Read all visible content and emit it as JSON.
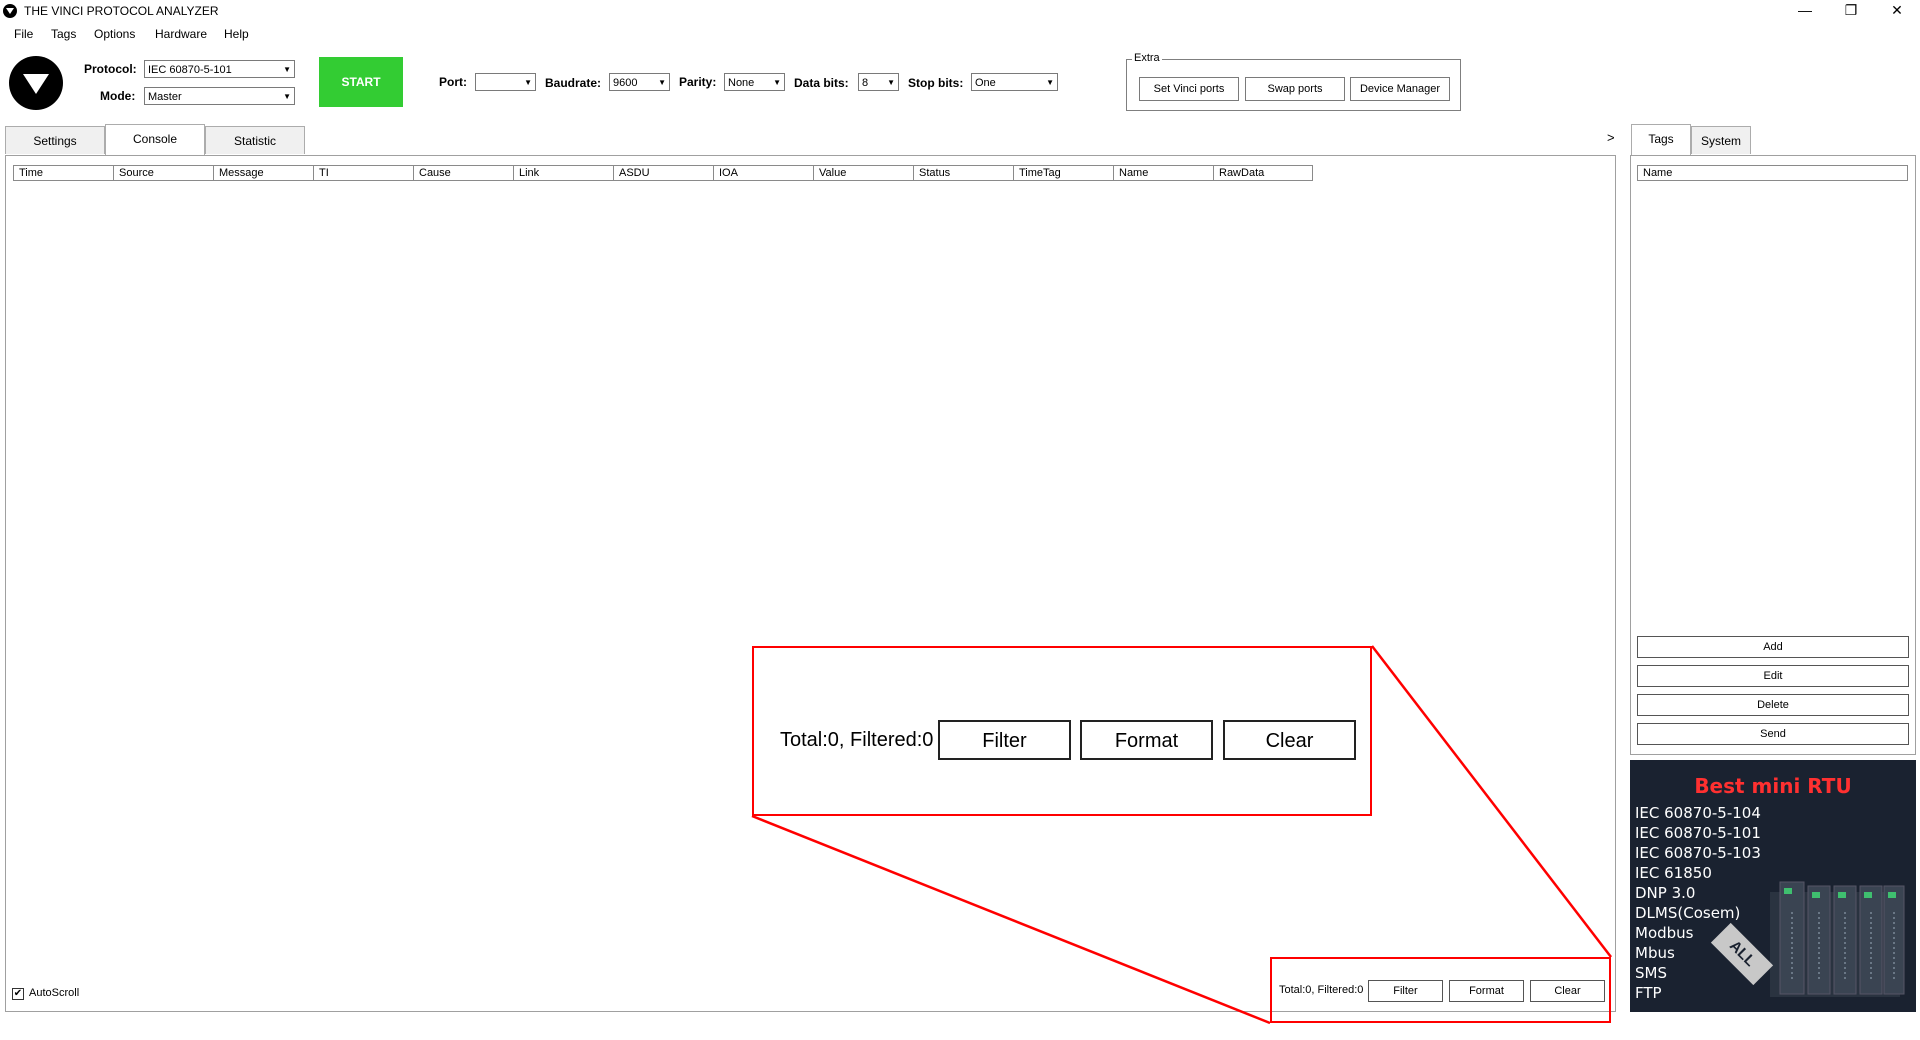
{
  "window": {
    "title": "THE VINCI PROTOCOL ANALYZER",
    "controls": {
      "minimize": "—",
      "restore": "❐",
      "close": "✕"
    }
  },
  "menu": [
    "File",
    "Tags",
    "Options",
    "Hardware",
    "Help"
  ],
  "toolbar": {
    "protocol_label": "Protocol:",
    "protocol_value": "IEC 60870-5-101",
    "mode_label": "Mode:",
    "mode_value": "Master",
    "start_label": "START",
    "port_label": "Port:",
    "port_value": "",
    "baudrate_label": "Baudrate:",
    "baudrate_value": "9600",
    "parity_label": "Parity:",
    "parity_value": "None",
    "databits_label": "Data bits:",
    "databits_value": "8",
    "stopbits_label": "Stop bits:",
    "stopbits_value": "One"
  },
  "extra": {
    "legend": "Extra",
    "set_vinci_ports": "Set Vinci ports",
    "swap_ports": "Swap ports",
    "device_manager": "Device Manager"
  },
  "tabs": [
    "Settings",
    "Console",
    "Statistic"
  ],
  "active_tab": "Console",
  "console": {
    "columns": [
      "Time",
      "Source",
      "Message",
      "TI",
      "Cause",
      "Link",
      "ASDU",
      "IOA",
      "Value",
      "Status",
      "TimeTag",
      "Name",
      "RawData"
    ],
    "autoscroll_label": "AutoScroll",
    "autoscroll_checked": true,
    "total_text": "Total:0, Filtered:0",
    "filter_label": "Filter",
    "format_label": "Format",
    "clear_label": "Clear"
  },
  "zoom_callout": {
    "total_text": "Total:0, Filtered:0",
    "filter_label": "Filter",
    "format_label": "Format",
    "clear_label": "Clear",
    "highlight_color": "#ff0000"
  },
  "right_panel": {
    "expand_arrow": ">",
    "tabs": [
      "Tags",
      "System"
    ],
    "active_tab": "Tags",
    "column": "Name",
    "buttons": [
      "Add",
      "Edit",
      "Delete",
      "Send"
    ]
  },
  "ad": {
    "title": "Best mini RTU",
    "lines": [
      "IEC 60870-5-104",
      "IEC 60870-5-101",
      "IEC 60870-5-103",
      "IEC 61850",
      "DNP 3.0",
      "DLMS(Cosem)",
      "Modbus",
      "Mbus",
      "SMS",
      "FTP"
    ],
    "tag": "ALL"
  },
  "colors": {
    "start_button": "#33cc33",
    "callout_red": "#ff0000",
    "ad_background": "#1a2230",
    "ad_title": "#ff3030"
  }
}
